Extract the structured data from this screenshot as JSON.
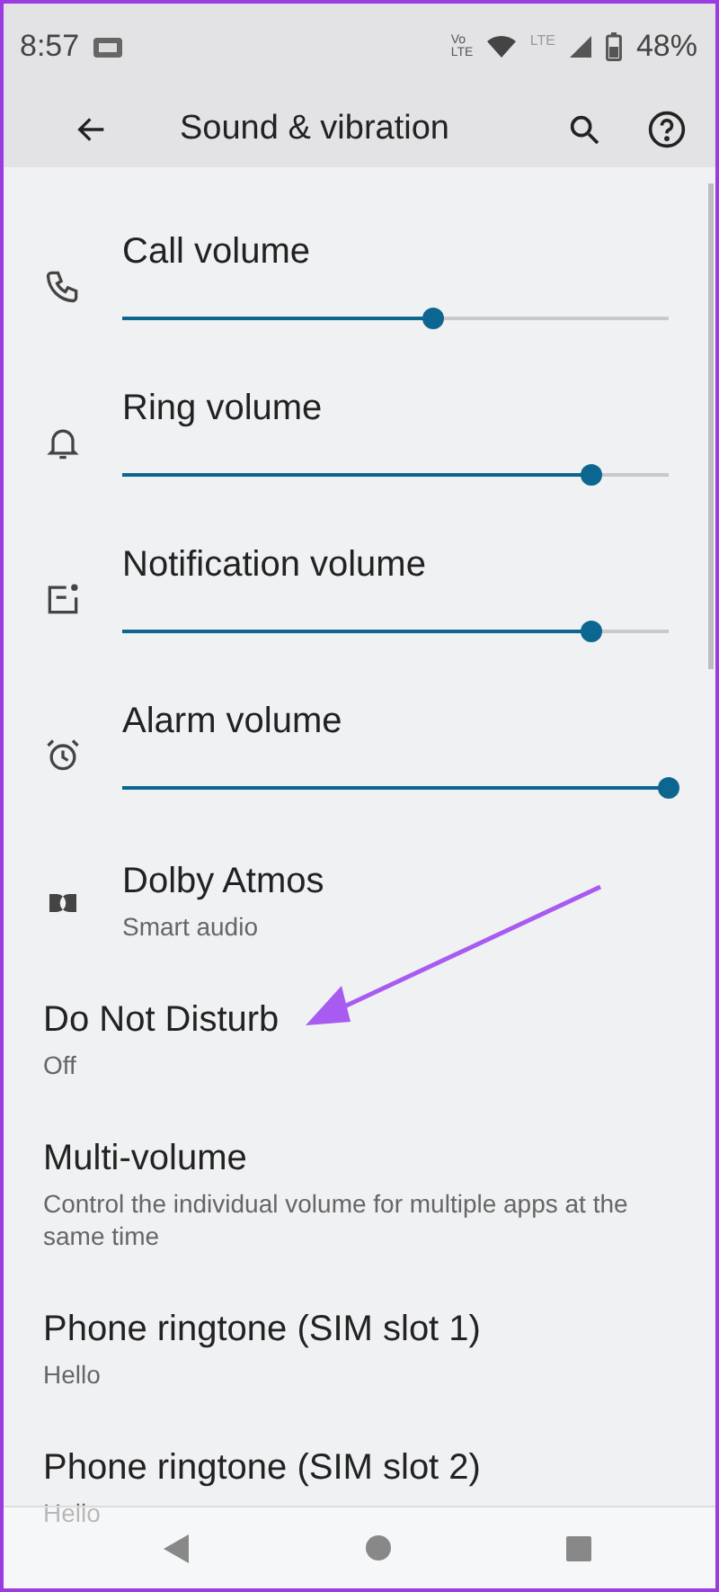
{
  "status_bar": {
    "time": "8:57",
    "volte": "Vo LTE",
    "network": "LTE",
    "battery": "48%"
  },
  "toolbar": {
    "title": "Sound & vibration"
  },
  "items": [
    {
      "kind": "slider",
      "title": "Call volume",
      "level": 0.57
    },
    {
      "kind": "slider",
      "title": "Ring volume",
      "level": 0.86
    },
    {
      "kind": "slider",
      "title": "Notification volume",
      "level": 0.86
    },
    {
      "kind": "slider",
      "title": "Alarm volume",
      "level": 1.0
    },
    {
      "kind": "text",
      "title": "Dolby Atmos",
      "subtitle": "Smart audio"
    },
    {
      "kind": "text",
      "title": "Do Not Disturb",
      "subtitle": "Off"
    },
    {
      "kind": "text",
      "title": "Multi-volume",
      "subtitle": "Control the individual volume for multiple apps at the same time"
    },
    {
      "kind": "text",
      "title": "Phone ringtone (SIM slot 1)",
      "subtitle": "Hello"
    },
    {
      "kind": "text",
      "title": "Phone ringtone (SIM slot 2)",
      "subtitle": "Hello"
    }
  ]
}
